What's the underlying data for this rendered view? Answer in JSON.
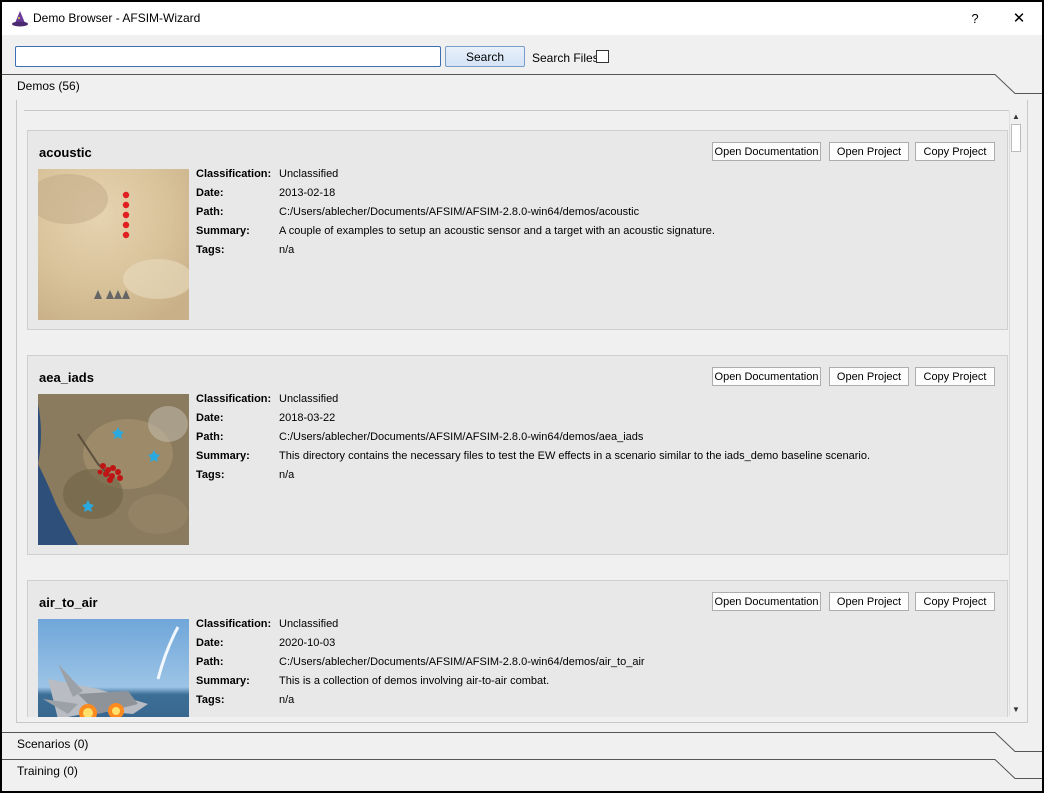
{
  "window": {
    "title": "Demo Browser - AFSIM-Wizard",
    "help_label": "?",
    "close_label": "✕"
  },
  "search": {
    "value": "",
    "placeholder": "",
    "button_label": "Search",
    "search_files_label": "Search Files",
    "search_files_checked": false
  },
  "sections": {
    "demos": "Demos (56)",
    "scenarios": "Scenarios (0)",
    "training": "Training (0)"
  },
  "field_labels": {
    "classification": "Classification:",
    "date": "Date:",
    "path": "Path:",
    "summary": "Summary:",
    "tags": "Tags:"
  },
  "buttons": {
    "open_documentation": "Open Documentation",
    "open_project": "Open Project",
    "copy_project": "Copy Project"
  },
  "demos": [
    {
      "name": "acoustic",
      "classification": "Unclassified",
      "date": "2013-02-18",
      "path": "C:/Users/ablecher/Documents/AFSIM/AFSIM-2.8.0-win64/demos/acoustic",
      "summary": "A couple of examples to setup an acoustic sensor and a target with an acoustic signature.",
      "tags": "n/a"
    },
    {
      "name": "aea_iads",
      "classification": "Unclassified",
      "date": "2018-03-22",
      "path": "C:/Users/ablecher/Documents/AFSIM/AFSIM-2.8.0-win64/demos/aea_iads",
      "summary": "This directory contains the necessary files to test the EW effects in a scenario similar to the iads_demo baseline scenario.",
      "tags": "n/a"
    },
    {
      "name": "air_to_air",
      "classification": "Unclassified",
      "date": "2020-10-03",
      "path": "C:/Users/ablecher/Documents/AFSIM/AFSIM-2.8.0-win64/demos/air_to_air",
      "summary": "This is a collection of demos involving air-to-air combat.",
      "tags": "n/a"
    }
  ]
}
